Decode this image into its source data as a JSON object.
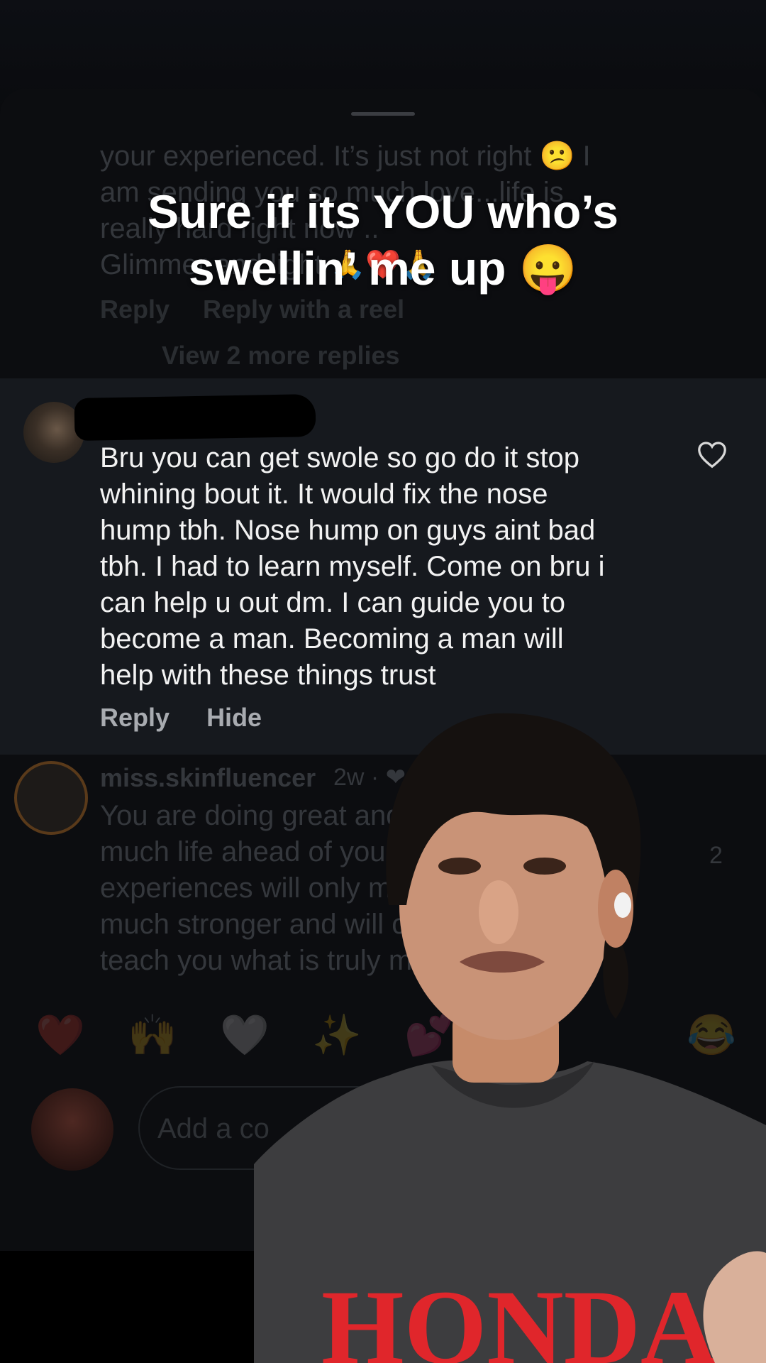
{
  "caption": {
    "line1": "Sure if its YOU who’s",
    "line2": "swellin’ me up 😛"
  },
  "prev_comment": {
    "lines": [
      "your experienced.  It’s just not right 😕 I",
      "am sending you so much love...life is",
      "really hard right now ..",
      "Glimmer and light 🙏❤️🙏"
    ],
    "reply": "Reply",
    "reply_reel": "Reply with a reel",
    "view_more": "View 2 more replies"
  },
  "main_comment": {
    "lines": [
      "Bru you can get swole so go do it stop",
      "whining bout it. It would fix the nose",
      "hump tbh. Nose hump on guys aint bad",
      "tbh. I had to learn myself. Come on bru i",
      "can help u out dm. I can guide you to",
      "become a man. Becoming a man will",
      "help with these things trust"
    ],
    "reply": "Reply",
    "hide": "Hide"
  },
  "next_comment": {
    "username": "miss.skinfluencer",
    "meta": "2w · ❤ by",
    "lines": [
      "You are doing great and y",
      "much life ahead of you! A",
      "experiences will only make",
      "much stronger and will co",
      "teach you what is truly mea"
    ],
    "like_count": "2"
  },
  "emoji_bar": [
    "❤️",
    "🙌",
    "🤍",
    "✨",
    "💕",
    "😂"
  ],
  "composer": {
    "placeholder": "Add a co"
  },
  "colors": {
    "sheet": "#0c0d10",
    "highlight": "#16191e",
    "caption": "#ffffff",
    "shirt_text": "#e0262b"
  },
  "shirt_text": "HONDA"
}
